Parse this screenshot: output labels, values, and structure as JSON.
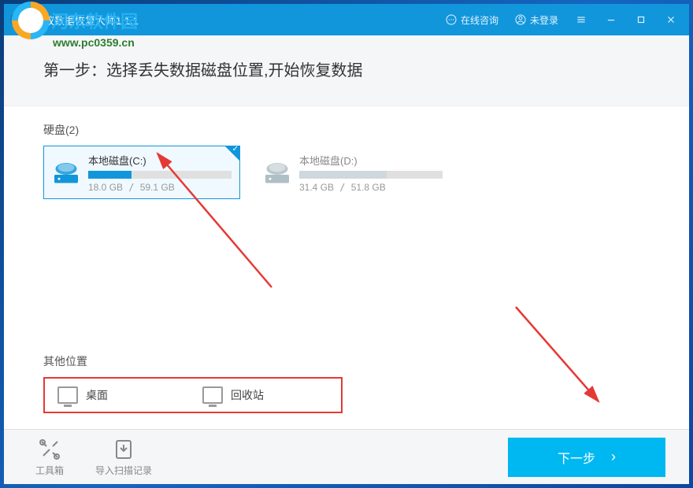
{
  "watermark": {
    "text": "河东软件园",
    "url": "www.pc0359.cn"
  },
  "titlebar": {
    "app_title": "蚂蚁数据恢复大师1.1.1",
    "consult": "在线咨询",
    "login": "未登录"
  },
  "step": {
    "title": "第一步：选择丢失数据磁盘位置,开始恢复数据"
  },
  "disks": {
    "label": "硬盘(2)",
    "items": [
      {
        "name": "本地磁盘(C:)",
        "used": "18.0 GB",
        "total": "59.1 GB",
        "percent": 30,
        "selected": true
      },
      {
        "name": "本地磁盘(D:)",
        "used": "31.4 GB",
        "total": "51.8 GB",
        "percent": 61,
        "selected": false
      }
    ]
  },
  "other": {
    "label": "其他位置",
    "desktop": "桌面",
    "recycle": "回收站"
  },
  "footer": {
    "toolbox": "工具箱",
    "import": "导入扫描记录",
    "next": "下一步"
  }
}
